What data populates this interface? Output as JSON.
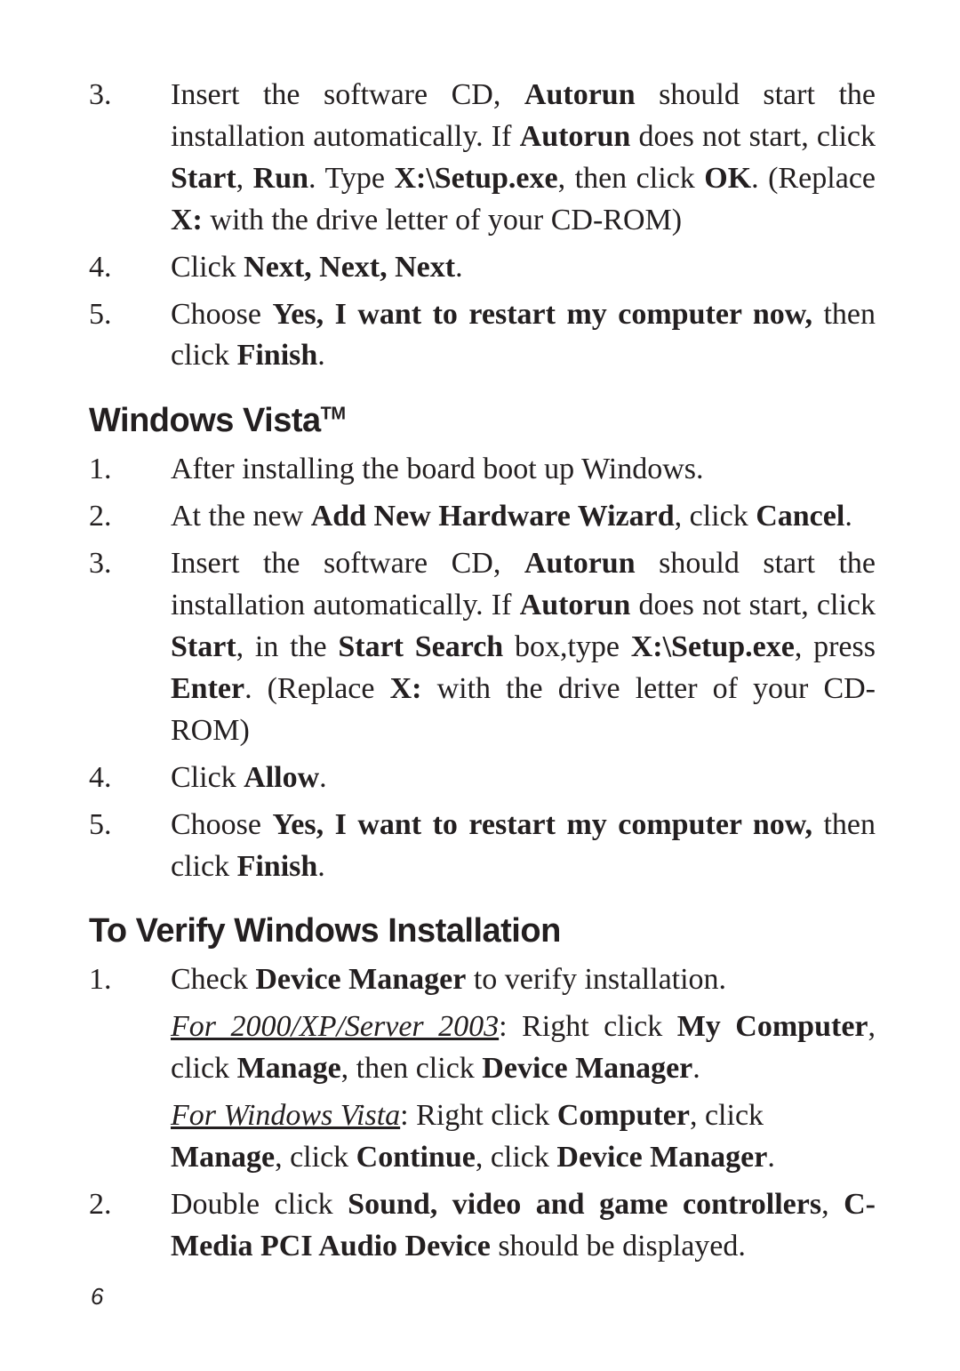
{
  "listA": {
    "item3": {
      "num": "3.",
      "text_a": "Insert the software CD, ",
      "b1": "Autorun",
      "text_b": " should start  the installation automatically.   If ",
      "b2": "Autorun",
      "text_c": " does not start, click ",
      "b3": "Start",
      "text_d": ", ",
      "b4": "Run",
      "text_e": ".   Type ",
      "b5": "X:\\Setup.exe",
      "text_f": ", then click ",
      "b6": "OK",
      "text_g": ".  (Replace ",
      "b7": "X:",
      "text_h": " with the drive letter of your CD-ROM)"
    },
    "item4": {
      "num": "4.",
      "text_a": "Click ",
      "b1": "Next, Next, Next",
      "text_b": "."
    },
    "item5": {
      "num": "5.",
      "text_a": "Choose ",
      "b1": "Yes, I want to restart my computer now,",
      "text_b": " then click ",
      "b2": "Finish",
      "text_c": "."
    }
  },
  "headingB": {
    "main": "Windows Vista",
    "tm": "TM"
  },
  "listB": {
    "item1": {
      "num": "1.",
      "text_a": "After installing the board boot up Windows."
    },
    "item2": {
      "num": "2.",
      "text_a": "At the new ",
      "b1": "Add New Hardware Wizard",
      "text_b": ", click ",
      "b2": "Cancel",
      "text_c": "."
    },
    "item3": {
      "num": "3.",
      "text_a": "Insert the software CD, ",
      "b1": "Autorun",
      "text_b": " should start the installation automatically.   If ",
      "b2": "Autorun",
      "text_c": " does not start, click ",
      "b3": "Start",
      "text_d": ", in the ",
      "b4": "Start Search",
      "text_e": " box,type ",
      "b5": "X:\\Setup.exe",
      "text_f": ", press ",
      "b6": "Enter",
      "text_g": ".  (Replace ",
      "b7": "X:",
      "text_h": " with the drive letter of your CD-ROM)"
    },
    "item4": {
      "num": "4.",
      "text_a": "Click ",
      "b1": "Allow",
      "text_b": "."
    },
    "item5": {
      "num": "5.",
      "text_a": "Choose ",
      "b1": "Yes, I want to restart my computer now,",
      "text_b": " then click ",
      "b2": "Finish",
      "text_c": "."
    }
  },
  "headingC": "To Verify Windows Installation",
  "listC": {
    "item1": {
      "num": "1.",
      "text_a": "Check ",
      "b1": "Device Manager",
      "text_b": " to verify installation.",
      "p2_u": "For 2000/XP/Server 2003",
      "p2_a": ": Right click ",
      "p2_b1": "My Computer",
      "p2_b": ", click ",
      "p2_b2": "Manage",
      "p2_c": ", then click ",
      "p2_b3": "Device Manager",
      "p2_d": ".",
      "p3_u": "For Windows Vista",
      "p3_a": ": Right click ",
      "p3_b1": "Computer",
      "p3_b": ", click ",
      "p3_b2": "Manage",
      "p3_c": ", click ",
      "p3_b3": "Continue",
      "p3_d": ", click ",
      "p3_b4": "Device Manager",
      "p3_e": "."
    },
    "item2": {
      "num": "2.",
      "text_a": "Double click ",
      "b1": "Sound, video and game controllers",
      "text_b": ", ",
      "b2": "C-Media PCI Audio Device",
      "text_c": " should be displayed."
    }
  },
  "pageNumber": "6"
}
